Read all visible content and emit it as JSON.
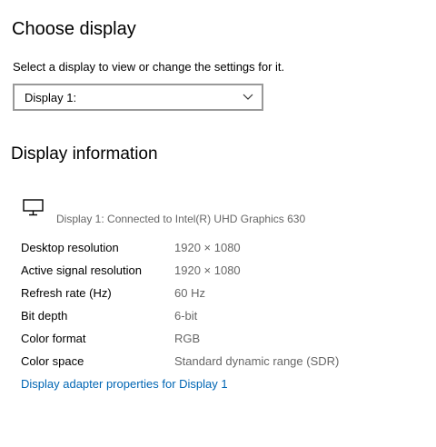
{
  "choose_display": {
    "title": "Choose display",
    "description": "Select a display to view or change the settings for it.",
    "selected_display": "Display 1:"
  },
  "display_info": {
    "title": "Display information",
    "icon": "monitor-icon",
    "connected_text": "Display 1: Connected to Intel(R) UHD Graphics 630",
    "rows": [
      {
        "label": "Desktop resolution",
        "value": "1920 × 1080"
      },
      {
        "label": "Active signal resolution",
        "value": "1920 × 1080"
      },
      {
        "label": "Refresh rate (Hz)",
        "value": "60 Hz"
      },
      {
        "label": "Bit depth",
        "value": "6-bit"
      },
      {
        "label": "Color format",
        "value": "RGB"
      },
      {
        "label": "Color space",
        "value": "Standard dynamic range (SDR)"
      }
    ],
    "adapter_link": "Display adapter properties for Display 1"
  },
  "colors": {
    "link": "#0066b4",
    "secondary_text": "#666666"
  }
}
